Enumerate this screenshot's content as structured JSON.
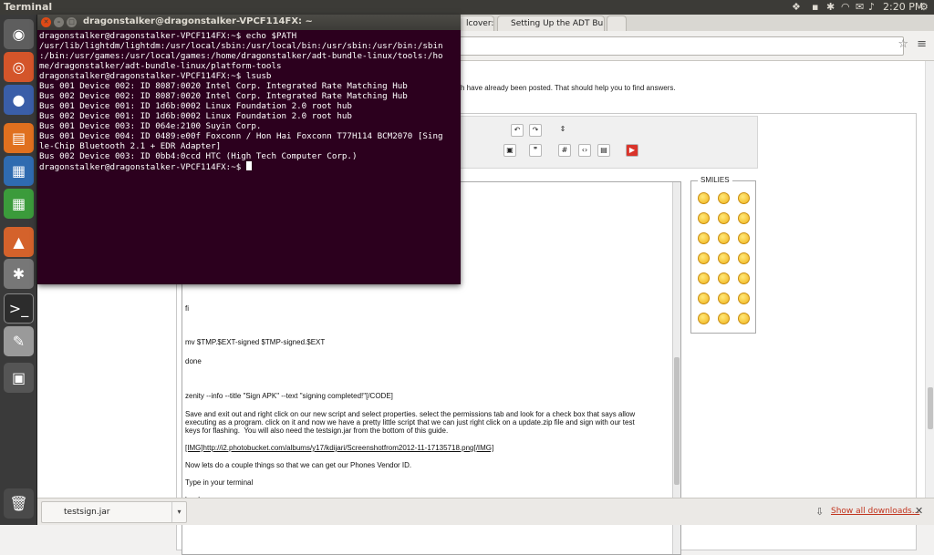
{
  "top_panel": {
    "app_title": "Terminal",
    "clock": "2:20 PM"
  },
  "launcher": {
    "items": [
      "dash",
      "chrome",
      "firefox",
      "files",
      "writer",
      "calc",
      "software-center",
      "system-settings",
      "terminal",
      "text-editor",
      "workspace-switcher",
      "trash"
    ]
  },
  "terminal": {
    "title": "dragonstalker@dragonstalker-VPCF114FX: ~",
    "lines": [
      "dragonstalker@dragonstalker-VPCF114FX:~$ echo $PATH",
      "/usr/lib/lightdm/lightdm:/usr/local/sbin:/usr/local/bin:/usr/sbin:/usr/bin:/sbin",
      ":/bin:/usr/games:/usr/local/games:/home/dragonstalker/adt-bundle-linux/tools:/ho",
      "me/dragonstalker/adt-bundle-linux/platform-tools",
      "dragonstalker@dragonstalker-VPCF114FX:~$ lsusb",
      "Bus 001 Device 002: ID 8087:0020 Intel Corp. Integrated Rate Matching Hub",
      "Bus 002 Device 002: ID 8087:0020 Intel Corp. Integrated Rate Matching Hub",
      "Bus 001 Device 001: ID 1d6b:0002 Linux Foundation 2.0 root hub",
      "Bus 002 Device 001: ID 1d6b:0002 Linux Foundation 2.0 root hub",
      "Bus 001 Device 003: ID 064e:2100 Suyin Corp.",
      "Bus 001 Device 004: ID 0489:e00f Foxconn / Hon Hai Foxconn T77H114 BCM2070 [Sing",
      "le-Chip Bluetooth 2.1 + EDR Adapter]",
      "Bus 002 Device 003: ID 0bb4:0ccd HTC (High Tech Computer Corp.)"
    ],
    "prompt": "dragonstalker@dragonstalker-VPCF114FX:~$ "
  },
  "browser": {
    "tabs": [
      {
        "label": "lcover:"
      },
      {
        "label": "Setting Up the ADT Bundl"
      }
    ],
    "help_text": "ch have already been posted. That should help you to find answers.",
    "editor_lines": [
      "fi",
      "",
      "mv $TMP.$EXT-signed $TMP-signed.$EXT",
      "done",
      "",
      "zenity --info --title \"Sign APK\" --text \"signing completed!\"[/CODE]",
      "Save and exit out and right click on our new script and select properties. select the permissions tab and look for a check box that says allow",
      "executing as a program. click on it and now we have a pretty little script that we can just right click on a update.zip file and sign with our test",
      "keys for flashing.  You will also need the testsign.jar from the bottom of this guide.",
      "[IMG]http://i2.photobucket.com/albums/y17/kdijari/Screenshotfrom2012-11-17135718.png[/IMG]",
      "Now lets do a couple things so that we can get our Phones Vendor ID.",
      "Type in your terminal",
      "lsusb"
    ],
    "smilies_title": "SMILIES",
    "download": {
      "filename": "testsign.jar",
      "show_all": "Show all downloads..."
    }
  },
  "colors": {
    "terminal_bg": "#2c001e",
    "panel_bg": "#3c3b37",
    "launcher_bg": "#3a3a3a",
    "link_red": "#c2351f"
  }
}
